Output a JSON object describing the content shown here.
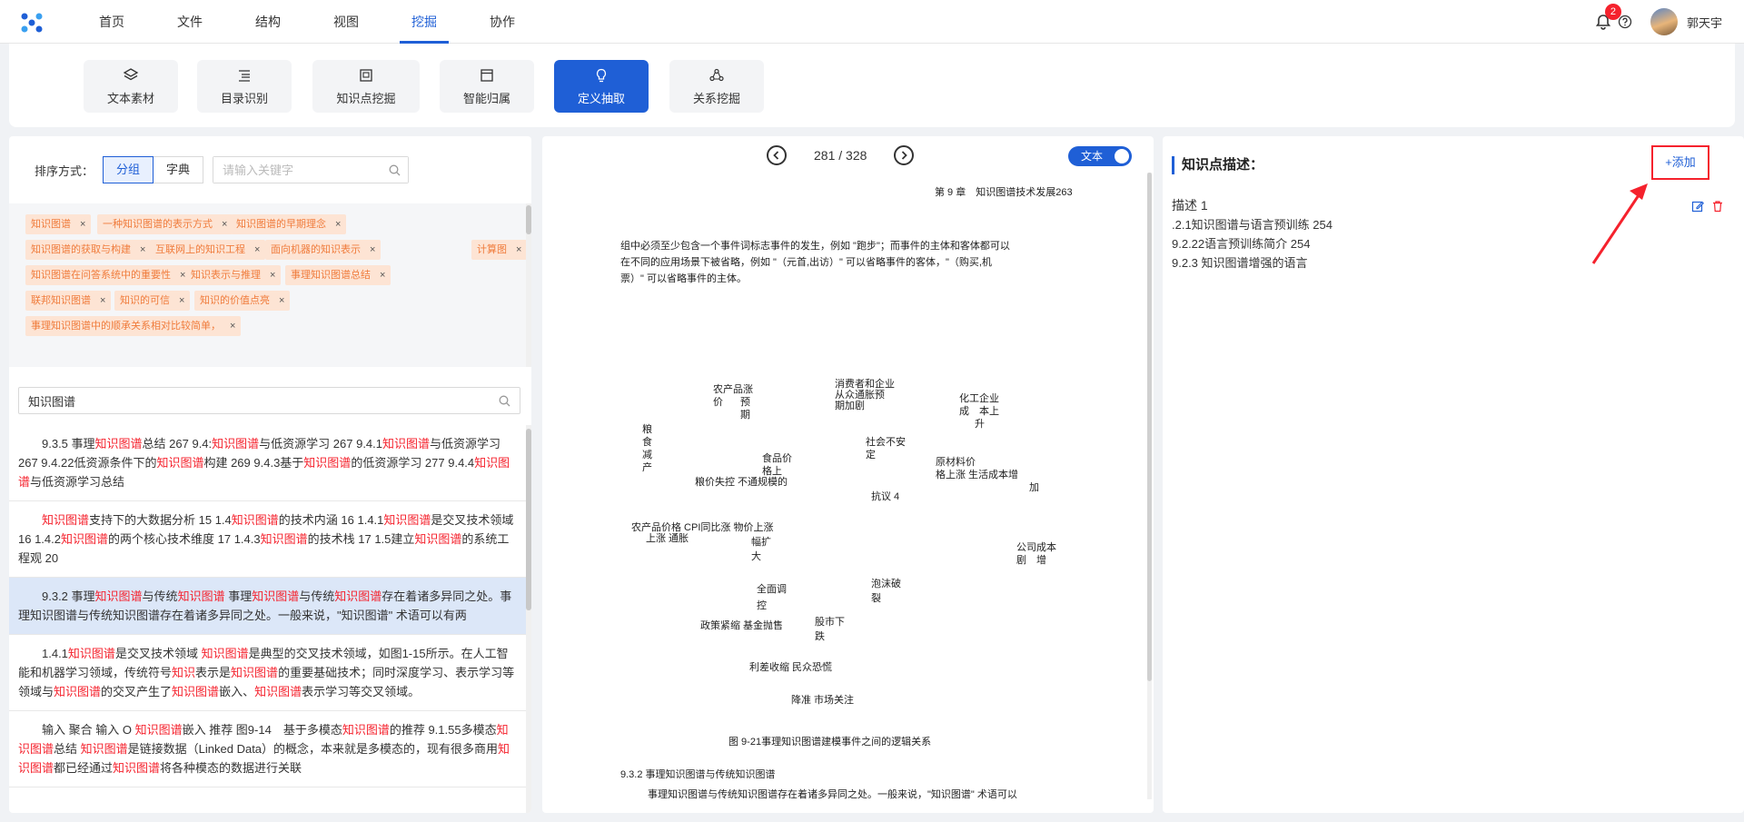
{
  "nav": {
    "items": [
      "首页",
      "文件",
      "结构",
      "视图",
      "挖掘",
      "协作"
    ],
    "active": 4
  },
  "header": {
    "notification_count": "2",
    "username": "郭天宇"
  },
  "toolbar": {
    "tools": [
      {
        "label": "文本素材",
        "icon": "layers-icon"
      },
      {
        "label": "目录识别",
        "icon": "list-indent-icon"
      },
      {
        "label": "知识点挖掘",
        "icon": "document-box-icon"
      },
      {
        "label": "智能归属",
        "icon": "window-icon"
      },
      {
        "label": "定义抽取",
        "icon": "lightbulb-icon"
      },
      {
        "label": "关系挖掘",
        "icon": "cycle-icon"
      }
    ],
    "active": 4
  },
  "left": {
    "sort_label": "排序方式：",
    "sort_options": [
      "分组",
      "字典"
    ],
    "sort_active": 0,
    "keyword_placeholder": "请输入关键字",
    "tags": [
      "知识图谱",
      "一种知识图谱的表示方式",
      "知识图谱的早期理念",
      "知识图谱的获取与构建",
      "互联网上的知识工程",
      "面向机器的知识表示",
      "计算图",
      "知识图谱在问答系统中的重要性",
      "知识表示与推理",
      "事理知识图谱总结",
      "联邦知识图谱",
      "知识的可信",
      "知识的价值点亮",
      "事理知识图谱中的顺承关系相对比较简单，"
    ],
    "search_value": "知识图谱"
  },
  "doc": {
    "page": "281 / 328",
    "toggle_label": "文本",
    "chapter_header": "第 9 章　知识图谱技术发展263",
    "para1": [
      "组中必须至少包含一个事件词标志事件的发生，例如 \"跑步\"；而事件的主体和客体都可以",
      "在不同的应用场景下被省略，例如 \"（元首,出访）\" 可以省略事件的客体，\"（购买,机",
      "票）\" 可以省略事件的主体。"
    ],
    "figure_caption": "图 9-21事理知识图谱建模事件之间的逻辑关系",
    "section_title": "9.3.2 事理知识图谱与传统知识图谱",
    "para2": "事理知识图谱与传统知识图谱存在着诸多异同之处。一般来说，\"知识图谱\" 术语可以"
  },
  "right": {
    "title": "知识点描述：",
    "add_label": "+添加",
    "desc_title": "描述 1",
    "desc_lines": [
      ".2.1知识图谱与语言预训练 254",
      "9.2.22语言预训练简介 254",
      "9.2.3 知识图谱增强的语言"
    ]
  },
  "colors": {
    "accent": "#1f5fd6",
    "highlight": "#f5222d",
    "tag_bg": "#fde4d4",
    "tag_text": "#f07c3c"
  }
}
